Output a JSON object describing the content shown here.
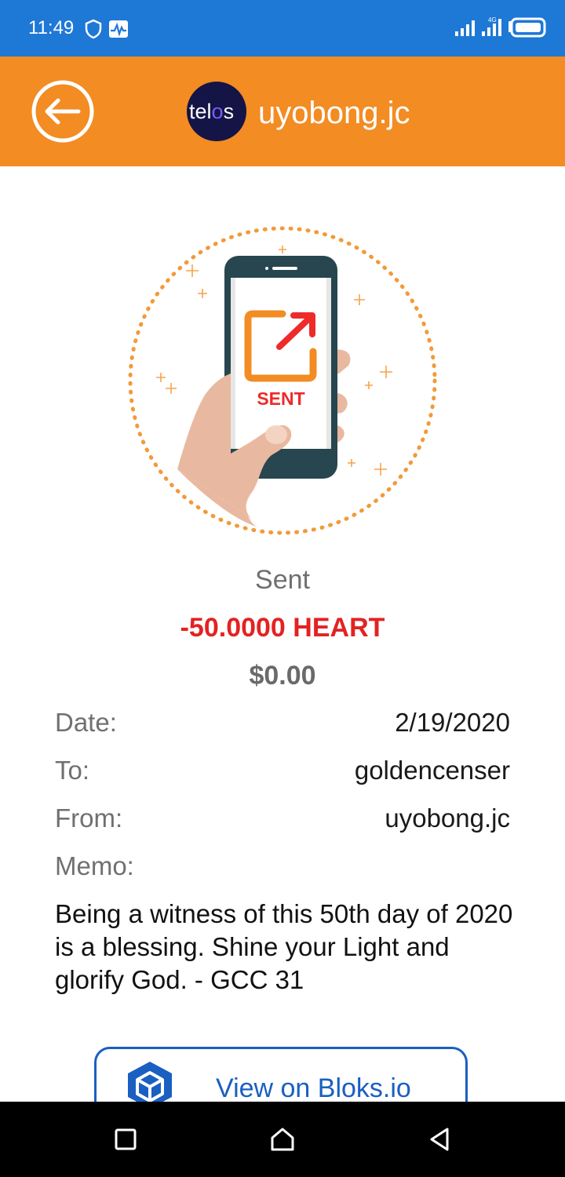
{
  "status_bar": {
    "time": "11:49",
    "icons": [
      "shield-icon",
      "pulse-icon",
      "signal-icon",
      "signal-icon",
      "battery-icon"
    ]
  },
  "header": {
    "back_icon": "back-arrow-icon",
    "logo_text": "telos",
    "title": "uyobong.jc"
  },
  "illustration": {
    "screen_text": "SENT",
    "icon": "sent-phone-icon"
  },
  "summary": {
    "label": "Sent",
    "amount": "-50.0000 HEART",
    "fiat": "$0.00"
  },
  "details": [
    {
      "label": "Date:",
      "value": "2/19/2020"
    },
    {
      "label": "To:",
      "value": "goldencenser"
    },
    {
      "label": "From:",
      "value": "uyobong.jc"
    }
  ],
  "memo": {
    "label": "Memo:",
    "text": "Being a witness of this 50th day of 2020 is a blessing. Shine your Light and glorify God. - GCC 31"
  },
  "actions": {
    "view_label": "View on Bloks.io",
    "view_icon": "cube-icon"
  },
  "nav_bar": {
    "buttons": [
      "recent-apps-icon",
      "home-icon",
      "back-icon"
    ]
  },
  "colors": {
    "status_bar": "#1e78d6",
    "app_bar": "#f28c23",
    "amount": "#e32222",
    "link": "#1a5fc2"
  }
}
